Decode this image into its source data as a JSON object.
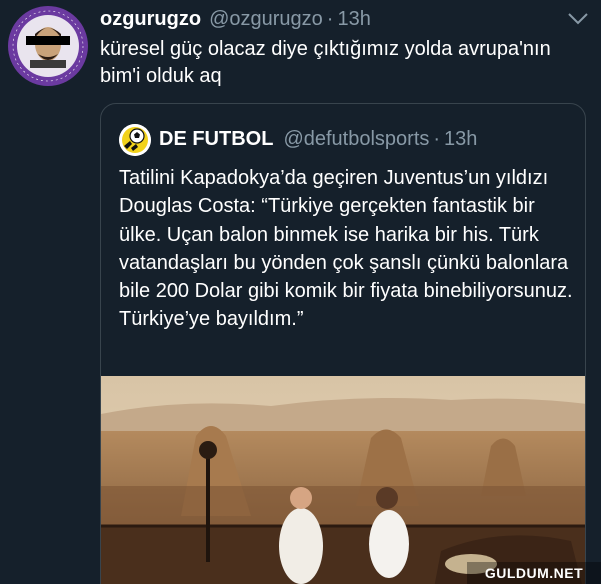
{
  "tweet": {
    "author_name": "ozgurugzo",
    "author_handle": "@ozgurugzo",
    "separator": "·",
    "time": "13h",
    "text": "küresel güç olacaz diye çıktığımız yolda avrupa'nın bim'i olduk aq",
    "avatar_icon": "masked-face-avatar",
    "menu_icon": "chevron-down-icon"
  },
  "quoted_tweet": {
    "author_name": "DE FUTBOL",
    "author_handle": "@defutbolsports",
    "separator": "·",
    "time": "13h",
    "avatar_icon": "football-logo-icon",
    "text": "Tatilini Kapadokya’da geçiren Juventus’un yıldızı Douglas Costa: “Türkiye gerçekten fantastik bir ülke. Uçan balon binmek ise harika bir his. Türk vatandaşları bu yönden çok şanslı çünkü balonlara bile 200 Dolar gibi komik bir fiyata binebiliyorsunuz. Türkiye’ye bayıldım.”",
    "media": "photo-two-men-on-terrace-cappadocia"
  },
  "watermark": {
    "text": "GULDUM.NET"
  },
  "colors": {
    "background": "#15202b",
    "text": "#ffffff",
    "muted": "#8899a6",
    "border": "#38444d",
    "avatar_ring": "#6b3aa0"
  }
}
